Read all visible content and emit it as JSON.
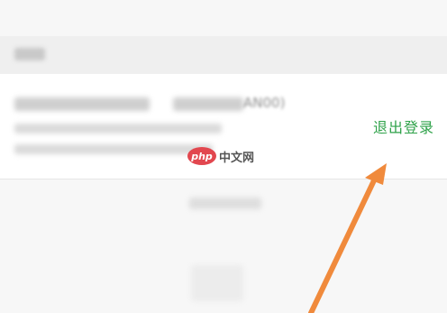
{
  "settings": {
    "logout_label": "退出登录",
    "device_model_tail": "AN00)"
  },
  "watermark": {
    "logo_text": "php",
    "site_name": "中文网"
  },
  "colors": {
    "logout_green": "#2fa24a",
    "arrow_orange": "#f08a3c",
    "watermark_red": "#e2474f"
  },
  "icons": {
    "arrow": "arrow-up-right-icon"
  }
}
